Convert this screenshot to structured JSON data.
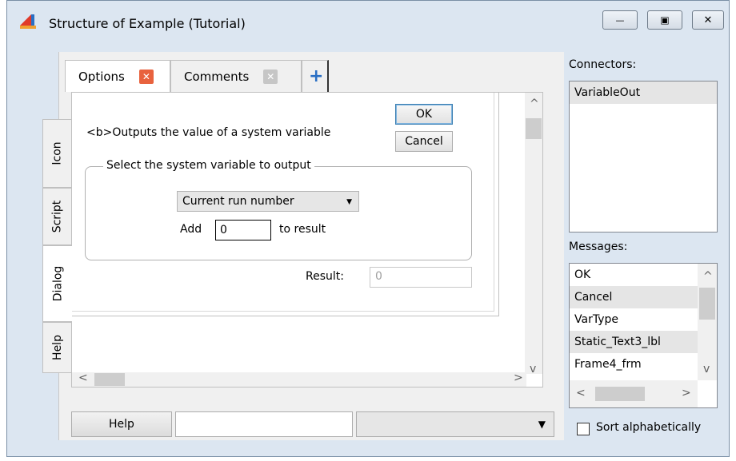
{
  "window": {
    "title": "Structure of Example (Tutorial)",
    "minimize_glyph": "—",
    "maximize_glyph": "▣",
    "close_glyph": "✕"
  },
  "top_tabs": [
    {
      "label": "Options",
      "close": "✕"
    },
    {
      "label": "Comments",
      "close": "✕"
    }
  ],
  "add_tab_glyph": "+",
  "side_tabs": [
    "Icon",
    "Script",
    "Dialog",
    "Help"
  ],
  "dialog": {
    "description": "<b>Outputs the value of a system variable",
    "ok_label": "OK",
    "cancel_label": "Cancel",
    "group_title": "Select the system variable to output",
    "variable_selected": "Current run number",
    "add_label": "Add",
    "add_value": "0",
    "to_result_label": "to result",
    "result_label": "Result:",
    "result_value": "0"
  },
  "scroll": {
    "up": "^",
    "down": "v",
    "left": "<",
    "right": ">"
  },
  "bottom": {
    "help_label": "Help",
    "text_value": "",
    "combo_arrow": "▼"
  },
  "connectors": {
    "label": "Connectors:",
    "items": [
      "VariableOut"
    ]
  },
  "messages": {
    "label": "Messages:",
    "items": [
      "OK",
      "Cancel",
      "VarType",
      "Static_Text3_lbl",
      "Frame4_frm"
    ]
  },
  "sort_label": "Sort alphabetically",
  "colors": {
    "window_bg": "#dce6f1",
    "close_tab_red": "#e8623e",
    "accent_blue": "#2a6fc4"
  }
}
